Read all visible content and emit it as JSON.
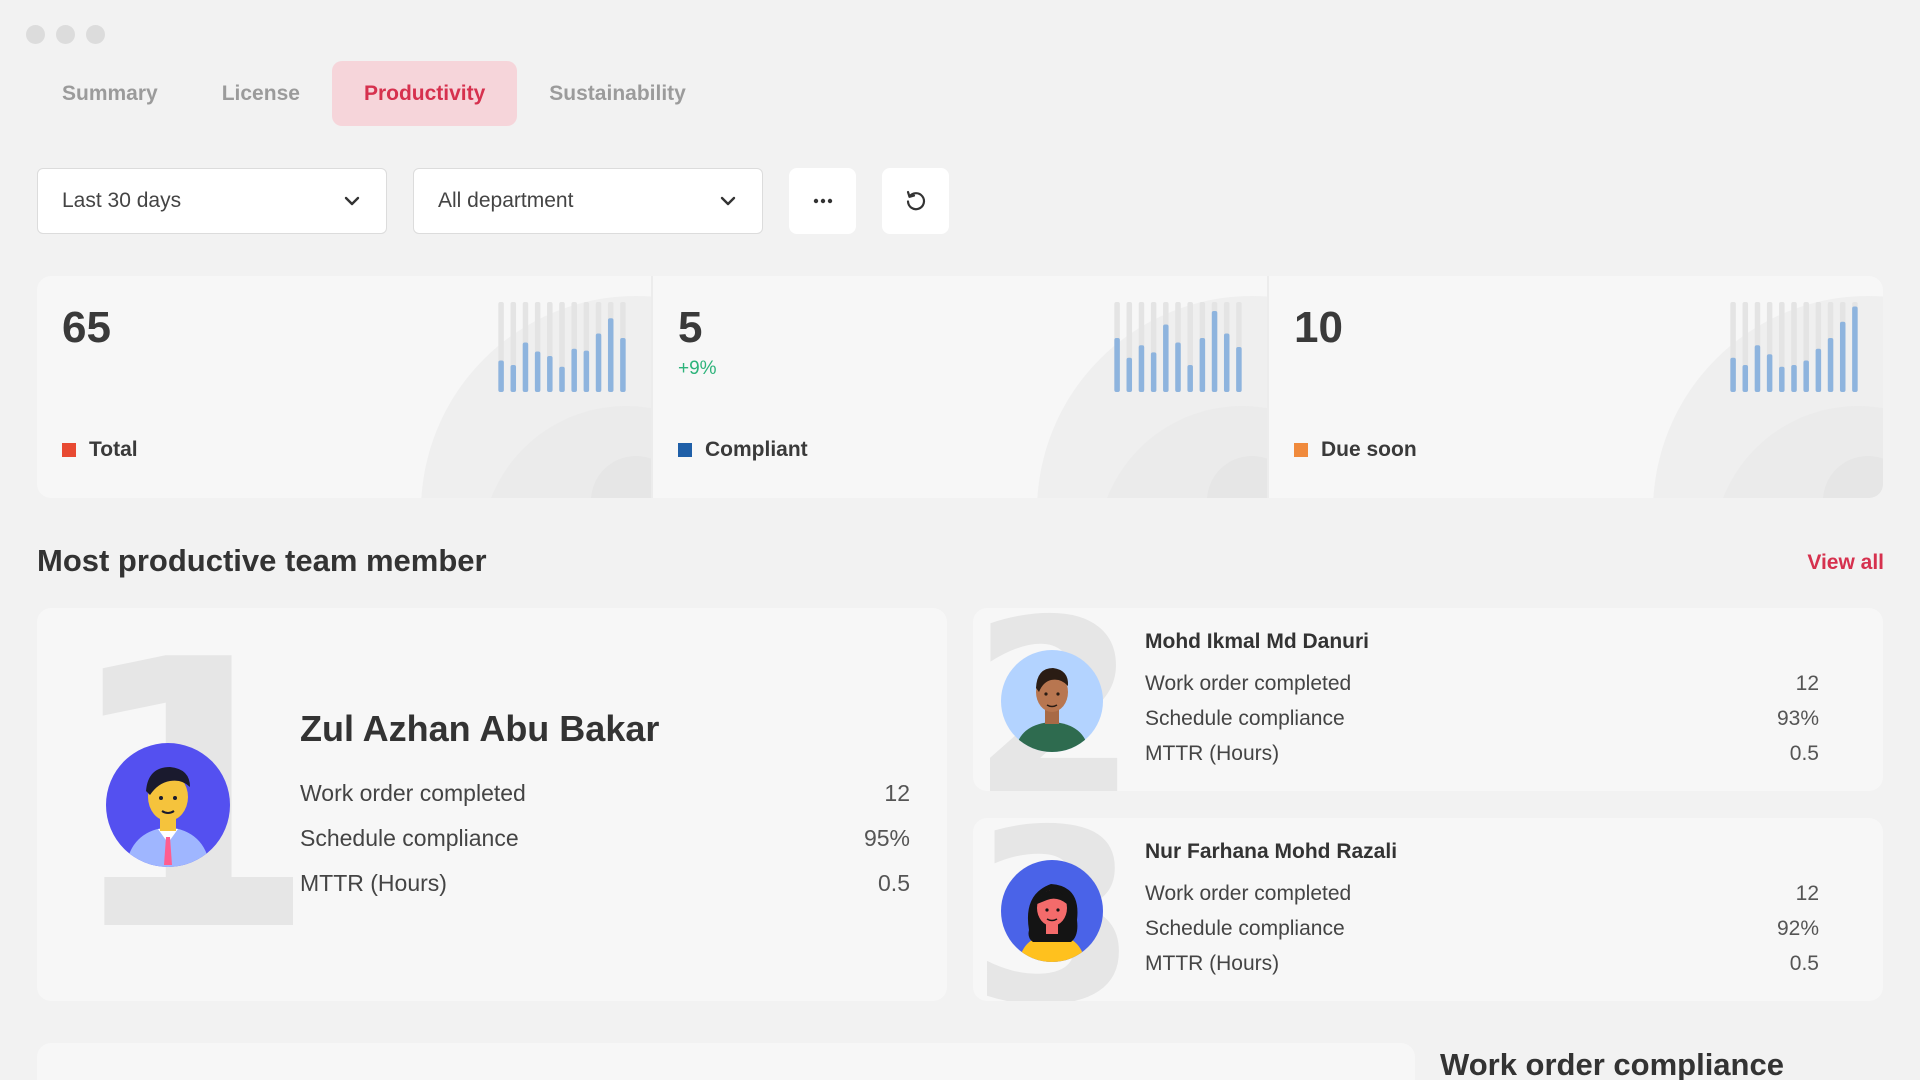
{
  "tabs": [
    {
      "label": "Summary",
      "active": false
    },
    {
      "label": "License",
      "active": false
    },
    {
      "label": "Productivity",
      "active": true
    },
    {
      "label": "Sustainability",
      "active": false
    }
  ],
  "filters": {
    "period": "Last 30 days",
    "department": "All department"
  },
  "stats": [
    {
      "value": "65",
      "delta": "",
      "label": "Total",
      "color": "#e84a32",
      "bars": [
        0.35,
        0.3,
        0.55,
        0.45,
        0.4,
        0.28,
        0.48,
        0.46,
        0.65,
        0.82,
        0.6
      ]
    },
    {
      "value": "5",
      "delta": "+9%",
      "label": "Compliant",
      "color": "#1f5fa8",
      "bars": [
        0.6,
        0.38,
        0.52,
        0.44,
        0.75,
        0.55,
        0.3,
        0.6,
        0.9,
        0.65,
        0.5
      ]
    },
    {
      "value": "10",
      "delta": "",
      "label": "Due soon",
      "color": "#f08a3c",
      "bars": [
        0.38,
        0.3,
        0.52,
        0.42,
        0.28,
        0.3,
        0.35,
        0.48,
        0.6,
        0.78,
        0.95
      ]
    }
  ],
  "section": {
    "title": "Most productive team member",
    "view_all": "View all"
  },
  "members": [
    {
      "rank": "1",
      "name": "Zul Azhan Abu Bakar",
      "metrics": [
        {
          "label": "Work order completed",
          "value": "12"
        },
        {
          "label": "Schedule compliance",
          "value": "95%"
        },
        {
          "label": "MTTR (Hours)",
          "value": "0.5"
        }
      ]
    },
    {
      "rank": "2",
      "name": "Mohd Ikmal Md Danuri",
      "metrics": [
        {
          "label": "Work order completed",
          "value": "12"
        },
        {
          "label": "Schedule compliance",
          "value": "93%"
        },
        {
          "label": "MTTR (Hours)",
          "value": "0.5"
        }
      ]
    },
    {
      "rank": "3",
      "name": "Nur Farhana Mohd Razali",
      "metrics": [
        {
          "label": "Work order completed",
          "value": "12"
        },
        {
          "label": "Schedule compliance",
          "value": "92%"
        },
        {
          "label": "MTTR (Hours)",
          "value": "0.5"
        }
      ]
    }
  ],
  "bottom": {
    "title": "Work order compliance"
  },
  "colors": {
    "accent": "#d6314e",
    "active_tab_bg": "#f6d5da",
    "bar": "#8eb4de",
    "bar_track": "#e4e4e4",
    "positive": "#2db37a"
  },
  "icons": [
    "chevron-down-icon",
    "more-icon",
    "refresh-icon"
  ]
}
